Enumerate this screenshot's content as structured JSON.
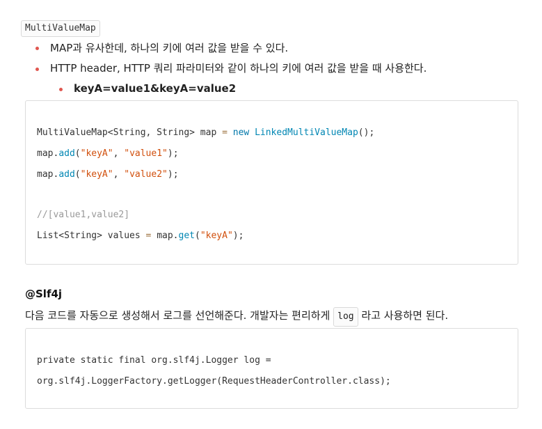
{
  "top_code": "MultiValueMap",
  "bullets": [
    "MAP과 유사한데, 하나의 키에 여러 값을 받을 수 있다.",
    "HTTP header, HTTP 쿼리 파라미터와 같이 하나의 키에 여러 값을 받을 때 사용한다."
  ],
  "sub_bullet": "keyA=value1&keyA=value2",
  "code1": {
    "l1": {
      "a": "MultiValueMap<String, String> map ",
      "op": "=",
      "sp": " ",
      "kw": "new",
      "sp2": " ",
      "fn": "LinkedMultiValueMap",
      "end": "();"
    },
    "l2": {
      "a": "map.",
      "fn": "add",
      "p1": "(",
      "s1": "\"keyA\"",
      "c": ", ",
      "s2": "\"value1\"",
      "end": ");"
    },
    "l3": {
      "a": "map.",
      "fn": "add",
      "p1": "(",
      "s1": "\"keyA\"",
      "c": ", ",
      "s2": "\"value2\"",
      "end": ");"
    },
    "comment": "//[value1,value2]",
    "l5": {
      "a": "List<String> values ",
      "op": "=",
      "b": " map.",
      "fn": "get",
      "p1": "(",
      "s1": "\"keyA\"",
      "end": ");"
    }
  },
  "heading": "@Slf4j",
  "para_before": "다음 코드를 자동으로 생성해서 로그를 선언해준다. 개발자는 편리하게",
  "para_code": "log",
  "para_after": "라고 사용하면 된다.",
  "code2": {
    "line1": "private static final org.slf4j.Logger log =",
    "line2": "org.slf4j.LoggerFactory.getLogger(RequestHeaderController.class);"
  }
}
